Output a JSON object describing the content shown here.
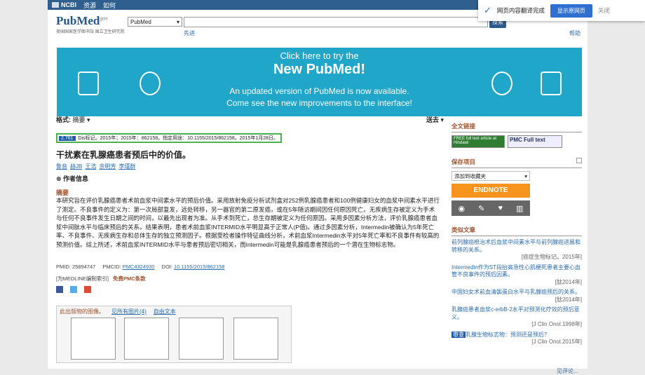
{
  "topbar": {
    "ncbi": "NCBI",
    "resources": "资源",
    "howto": "如何"
  },
  "search": {
    "logo": "PubMed",
    "logo_suffix": "gov",
    "logo_sub": "美国国家医学图书馆 国立卫生研究院",
    "db": "PubMed",
    "button": "搜索",
    "advanced": "先进",
    "help": "帮助"
  },
  "banner": {
    "line1": "Click here to try the",
    "line2": "New PubMed!",
    "line3": "An updated version of PubMed is now available.",
    "line4": "Come see the new improvements to the interface!"
  },
  "format": {
    "label": "格式:",
    "value": "摘要",
    "sendto": "送去"
  },
  "citation": {
    "score": "2.761",
    "text": "Dis标记。2015年；2015年：862158。指定用途：10.1155/2015/862158。2015年1月28日。"
  },
  "article": {
    "title": "干扰素在乳腺癌患者预后中的价值。",
    "authors": [
      "鲁音",
      "赫JB",
      "王浩",
      "余明芳",
      "李瑾群"
    ],
    "author_info": "作者信息",
    "abstract_heading": "摘要",
    "abstract": "本研究旨在评价乳腺癌患者术前血浆中间素水平的预后价值。采用放射免疫分析试剂盒对252例乳腺癌患者和100例健康妇女的血浆中间素水平进行了测定。不良事件的定义为：第一次局部复发，远处转移，另一器官的第二原发癌，或在5年随访期间因任何原因死亡。无疾病生存被定义为手术与任何不良事件发生日期之间的时间，以最先出现者为准。从手术到死亡，总生存期被定义为任何原因。采用多因素分析方法，评价乳腺癌患者血浆中间肽水平与临床预后的关系。结果表明，患者术前血浆INTERMID水平明显高于正常人(P值)。通过多因素分析，Intermedin被确认为5年死亡率、不良事件、无疾病生存和总体生存的独立预测因子。根据受检者操作特征曲线分析，术前血浆Intermedin水平对5年死亡率和不良事件有较高的预测价值。综上所述，术前血浆INTERMID水平与患者预后密切相关，而Intermedin可能是乳腺癌患者预后的一个潜在生物标志物。",
    "pmid_label": "PMID:",
    "pmid": "25894747",
    "pmcid_label": "PMCID:",
    "pmcid": "PMC4324930",
    "doi_label": "DOI:",
    "doi": "10.1155/2015/862158",
    "medline": "[为MEDLINE编制索引]",
    "free_pmc": "免费PMC条款"
  },
  "figures": {
    "heading": "此出版物的图像。",
    "see_all": "见所有图片(4)",
    "free_text": "自由文本"
  },
  "sidebar": {
    "fulltext_heading": "全文链接",
    "ft1": "FREE full text article at Hindawi",
    "ft2": "PMC Full text",
    "saved_heading": "保存项目",
    "add_collection": "添加到收藏夹",
    "endnote": "ENDNOTE",
    "similar_heading": "类似文章",
    "similar": [
      {
        "title": "前列腺癌根治术后血浆中间素水平与前列腺癌进展和转移的关系。",
        "src": "[癌症生物标记。2015年]"
      },
      {
        "title": "Intermedin作为ST段抬高急性心肌梗死患者主要心血管不良事件的预后因素。",
        "src": "[肽2014年]"
      },
      {
        "title": "中国妇女术前血清骺蛋白水平与乳腺癌预后的关系。",
        "src": "[肽2014年]"
      },
      {
        "title": "乳腺癌患者血浆c-erbB-2水平对预测化疗效的预后意义。",
        "src": "[J Clin Onol.1998年]"
      },
      {
        "title": "乳腺生物标志物：预测还是预后？",
        "tag": "审查",
        "src": "[J Clin Onol.2015年]"
      }
    ],
    "review": "见评论..."
  },
  "translate": {
    "done": "网页内容翻译完成",
    "show_original": "显示原网页",
    "close": "关闭"
  }
}
